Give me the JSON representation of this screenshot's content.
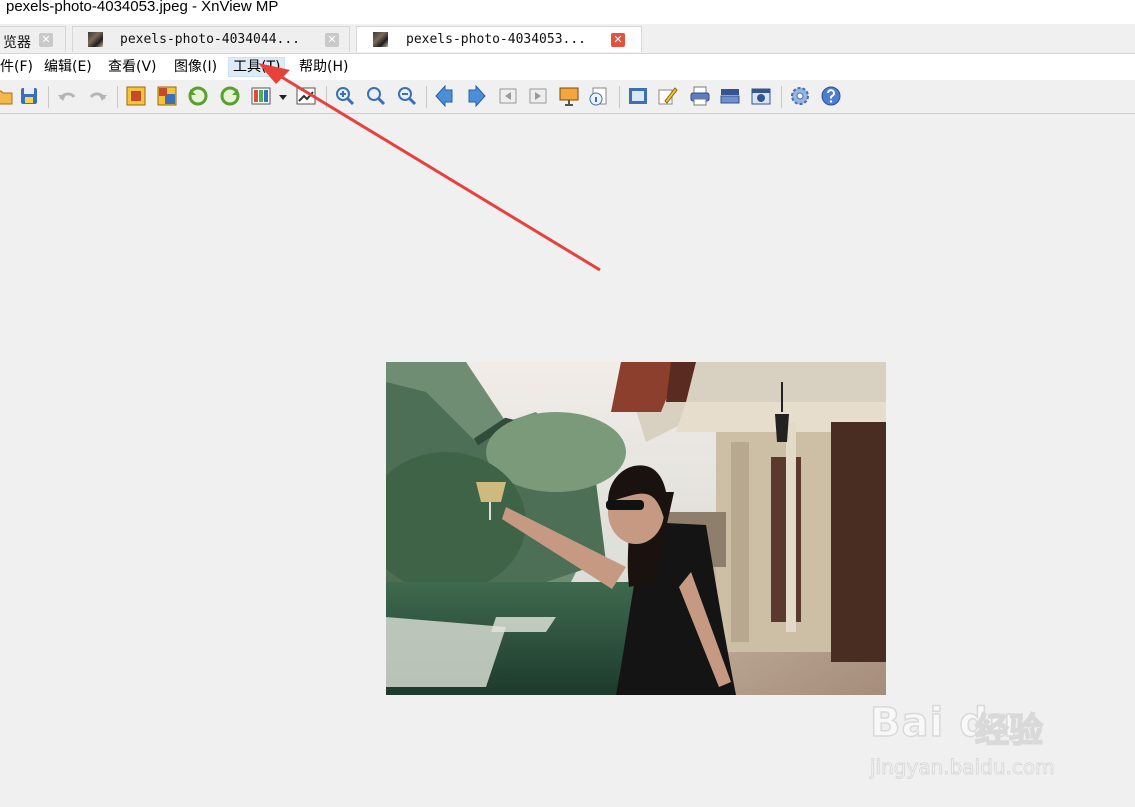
{
  "window": {
    "title": "pexels-photo-4034053.jpeg - XnView MP"
  },
  "tabs": [
    {
      "label": "览器",
      "active": false
    },
    {
      "label": "pexels-photo-4034044...",
      "active": false
    },
    {
      "label": "pexels-photo-4034053...",
      "active": true
    }
  ],
  "menu": {
    "items": [
      {
        "label": "件(F)"
      },
      {
        "label": "编辑(E)"
      },
      {
        "label": "查看(V)"
      },
      {
        "label": "图像(I)"
      },
      {
        "label": "工具(T)",
        "highlighted": true
      },
      {
        "label": "帮助(H)"
      }
    ]
  },
  "toolbar": {
    "icons": [
      "open-folder-icon",
      "save-icon",
      "undo-icon",
      "redo-icon",
      "crop-icon",
      "resize-icon",
      "rotate-left-icon",
      "rotate-right-icon",
      "adjust-colors-icon",
      "dropdown-arrow-icon",
      "levels-icon",
      "zoom-in-icon",
      "zoom-1to1-icon",
      "zoom-out-icon",
      "previous-icon",
      "next-icon",
      "first-icon",
      "last-icon",
      "slideshow-icon",
      "info-icon",
      "fit-screen-icon",
      "edit-icon",
      "print-icon",
      "scanner-icon",
      "capture-icon",
      "settings-icon",
      "help-icon"
    ]
  },
  "watermark": {
    "logo": "Bai du",
    "brand_cn": "经验",
    "url": "jingyan.baidu.com"
  },
  "colors": {
    "accent_arrow": "#e8413c",
    "active_tab_close": "#e2533f",
    "menu_highlight": "#ddebf7"
  }
}
